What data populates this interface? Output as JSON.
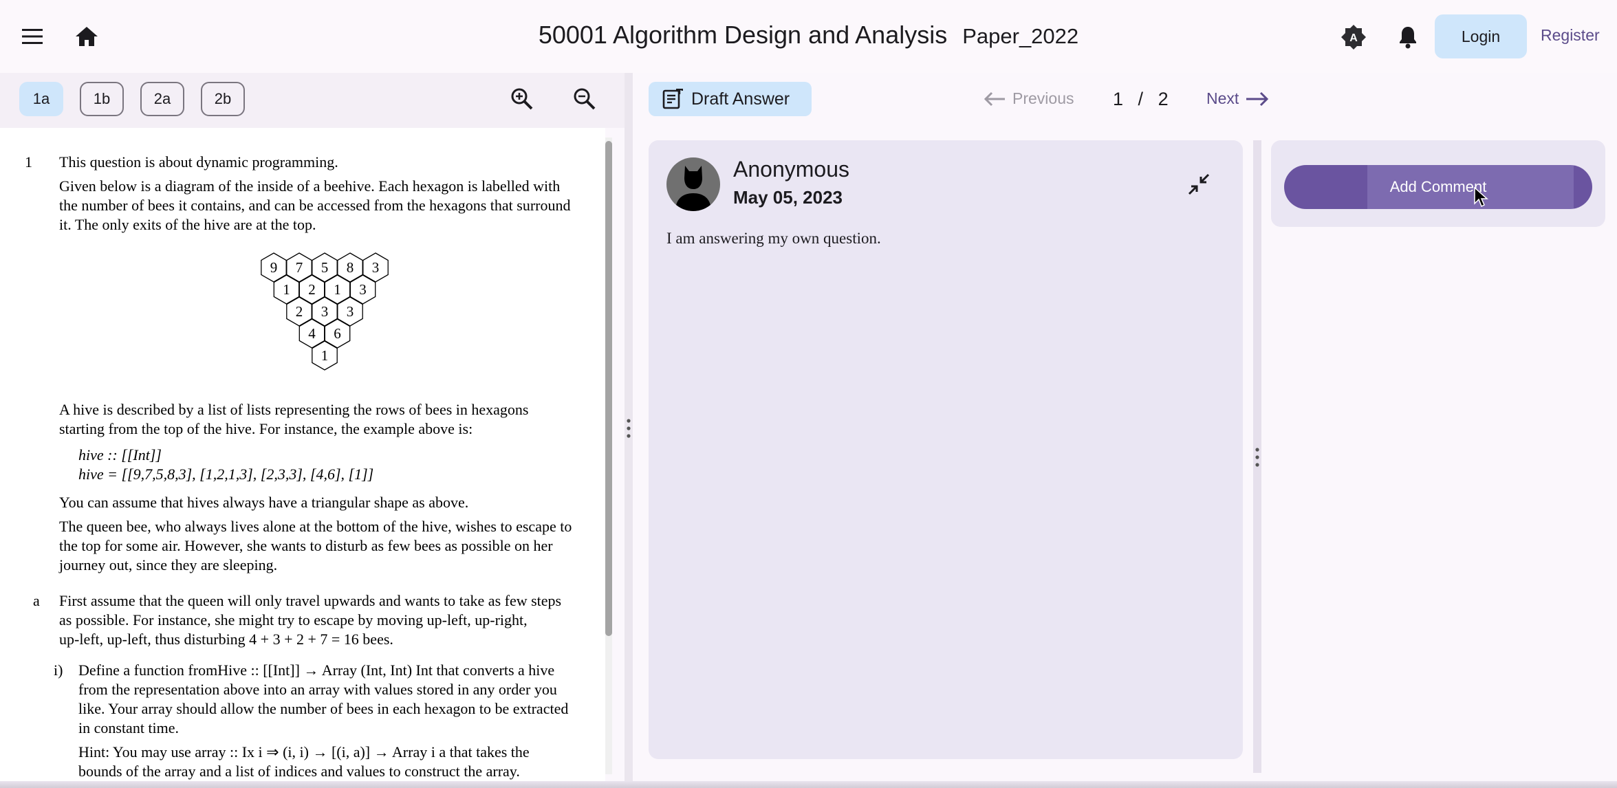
{
  "app": {
    "course_title": "50001 Algorithm Design and Analysis",
    "paper_label": "Paper_2022",
    "login_label": "Login",
    "register_label": "Register"
  },
  "question_tabs": [
    "1a",
    "1b",
    "2a",
    "2b"
  ],
  "active_tab": "1a",
  "pdf": {
    "q_number": "1",
    "intro": "This question is about dynamic programming.",
    "para1_l1": "Given below is a diagram of the inside of a beehive. Each hexagon is labelled with",
    "para1_l2": "the number of bees it contains, and can be accessed from the hexagons that surround",
    "para1_l3": "it. The only exits of the hive are at the top.",
    "hive_rows": [
      [
        "9",
        "7",
        "5",
        "8",
        "3"
      ],
      [
        "1",
        "2",
        "1",
        "3"
      ],
      [
        "2",
        "3",
        "3"
      ],
      [
        "4",
        "6"
      ],
      [
        "1"
      ]
    ],
    "para2_l1": "A hive is described by a list of lists representing the rows of bees in hexagons",
    "para2_l2": "starting from the top of the hive. For instance, the example above is:",
    "code1": "hive :: [[Int]]",
    "code2": "hive = [[9,7,5,8,3], [1,2,1,3], [2,3,3], [4,6], [1]]",
    "para3": "You can assume that hives always have a triangular shape as above.",
    "para4_l1": "The queen bee, who always lives alone at the bottom of the hive, wishes to escape to",
    "para4_l2": "the top for some air. However, she wants to disturb as few bees as possible on her",
    "para4_l3": "journey out, since they are sleeping.",
    "part_a_label": "a",
    "part_a_l1": "First assume that the queen will only travel upwards and wants to take as few steps",
    "part_a_l2": "as possible. For instance, she might try to escape by moving up-left, up-right,",
    "part_a_l3": "up-left, up-left, thus disturbing 4 + 3 + 2 + 7 = 16 bees.",
    "part_i_label": "i)",
    "part_i_l1": "Define a function fromHive :: [[Int]] → Array (Int, Int) Int that converts a hive",
    "part_i_l2": "from the representation above into an array with values stored in any order you",
    "part_i_l3": "like. Your array should allow the number of bees in each hexagon to be extracted",
    "part_i_l4": "in constant time.",
    "hint_l1": "Hint: You may use array :: Ix i ⇒ (i, i) → [(i, a)] → Array i a that takes the",
    "hint_l2": "bounds of the array and a list of indices and values to construct the array."
  },
  "toolbar": {
    "draft_label": "Draft Answer",
    "prev_label": "Previous",
    "next_label": "Next",
    "page_current": "1",
    "page_sep": "/",
    "page_total": "2"
  },
  "answer": {
    "author": "Anonymous",
    "date": "May 05, 2023",
    "text": "I am answering my own question."
  },
  "comments": {
    "add_label": "Add Comment"
  },
  "colors": {
    "accent": "#6a54a0",
    "chip_active": "#cfe6fb",
    "card_bg": "#eae6f3"
  },
  "icons": [
    "menu-icon",
    "home-icon",
    "theme-icon",
    "bell-icon",
    "zoom-in-icon",
    "zoom-out-icon",
    "draft-icon",
    "arrow-left-icon",
    "arrow-right-icon",
    "collapse-icon",
    "person-icon",
    "cursor-icon"
  ]
}
